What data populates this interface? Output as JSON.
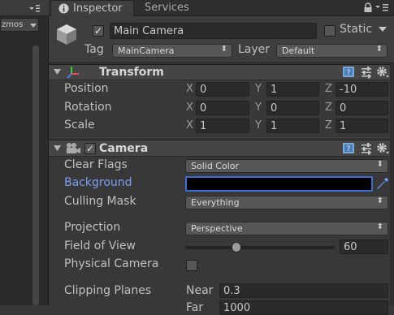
{
  "left_panel": {
    "gizmos_label": "zmos"
  },
  "tabs": {
    "inspector": "Inspector",
    "services": "Services"
  },
  "header": {
    "object_name": "Main Camera",
    "static_label": "Static",
    "tag_label": "Tag",
    "tag_value": "MainCamera",
    "layer_label": "Layer",
    "layer_value": "Default"
  },
  "transform": {
    "title": "Transform",
    "rows": [
      {
        "label": "Position",
        "x": "0",
        "y": "1",
        "z": "-10"
      },
      {
        "label": "Rotation",
        "x": "0",
        "y": "0",
        "z": "0"
      },
      {
        "label": "Scale",
        "x": "1",
        "y": "1",
        "z": "1"
      }
    ],
    "axes": {
      "x": "X",
      "y": "Y",
      "z": "Z"
    }
  },
  "camera": {
    "title": "Camera",
    "clear_flags_label": "Clear Flags",
    "clear_flags_value": "Solid Color",
    "background_label": "Background",
    "background_color": "#000000",
    "culling_mask_label": "Culling Mask",
    "culling_mask_value": "Everything",
    "projection_label": "Projection",
    "projection_value": "Perspective",
    "fov_label": "Field of View",
    "fov_value": "60",
    "fov_fraction": 0.34,
    "physical_camera_label": "Physical Camera",
    "clipping_planes_label": "Clipping Planes",
    "near_label": "Near",
    "near_value": "0.3",
    "far_label": "Far",
    "far_value": "1000"
  },
  "colors": {
    "accent_label": "#7b9ef0",
    "selection_border": "#3d6cd8"
  },
  "icons": {
    "inspector_tab": "info-icon",
    "cube": "cube-icon",
    "transform": "transform-axes-icon",
    "camera": "camera-icon",
    "help": "help-book-icon",
    "presets": "presets-sliders-icon",
    "settings": "gear-icon",
    "eyedropper": "eyedropper-icon",
    "lock": "lock-icon",
    "menu": "menu-icon"
  }
}
